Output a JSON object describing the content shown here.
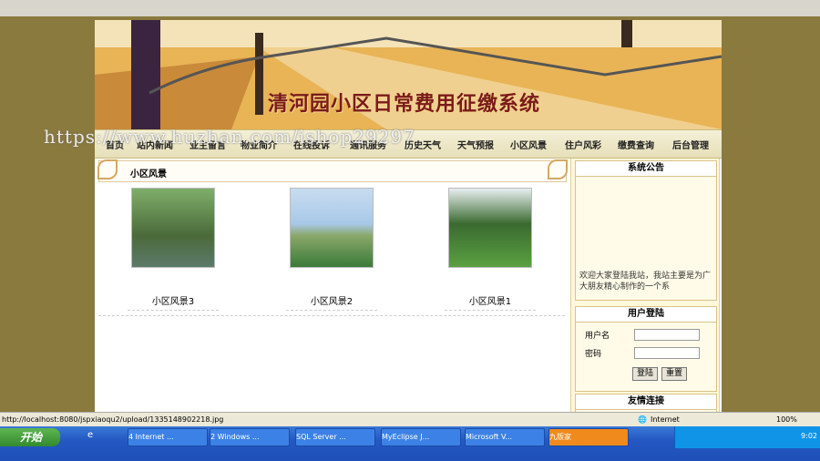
{
  "banner": {
    "title": "清河园小区日常费用征缴系统"
  },
  "watermark": "https://www.huzhan.com/ishop29297",
  "nav": [
    "首页",
    "站内新闻",
    "业主留言",
    "物业简介",
    "在线投诉",
    "通讯服务",
    "历史天气",
    "天气预报",
    "小区风景",
    "住户风彩",
    "缴费查询",
    "后台管理"
  ],
  "content": {
    "section_title": "小区风景",
    "photos": [
      {
        "label": "小区风景3"
      },
      {
        "label": "小区风景2"
      },
      {
        "label": "小区风景1"
      }
    ]
  },
  "sidebar": {
    "notice_title": "系统公告",
    "notice_text": "欢迎大家登陆我站，我站主要是为广大朋友精心制作的一个系",
    "login_title": "用户登陆",
    "username_label": "用户名",
    "password_label": "密码",
    "login_button": "登陆",
    "reset_button": "重置",
    "links_title": "友情连接"
  },
  "status": {
    "url": "http://localhost:8080/jspxiaoqu2/upload/1335148902218.jpg",
    "zone": "Internet",
    "zoom": "100%"
  },
  "taskbar": {
    "start": "开始",
    "tasks": [
      "4 Internet ...",
      "2 Windows ...",
      "SQL Server ...",
      "MyEclipse J...",
      "Microsoft V...",
      "九版家"
    ],
    "time": "9:02"
  }
}
